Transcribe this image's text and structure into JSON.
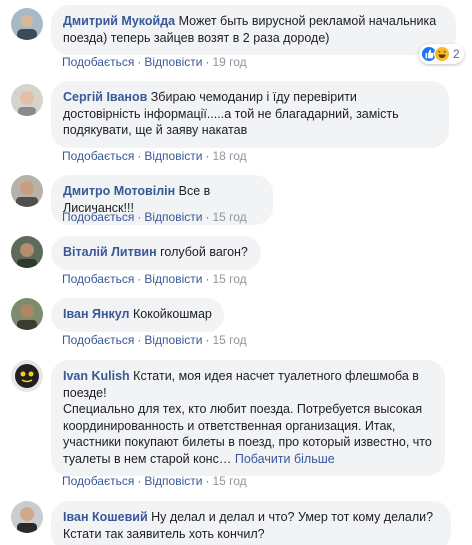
{
  "actions": {
    "like": "Подобається",
    "reply": "Відповісти",
    "separator": "·"
  },
  "reactions": {
    "count": "2",
    "icons": [
      "like-icon",
      "haha-icon"
    ]
  },
  "comments": [
    {
      "author": "Дмитрий Мукойда",
      "text": "Может быть вирусной рекламой начальника поезда) теперь зайцев возят в 2 раза дороде)",
      "time": "19 год"
    },
    {
      "author": "Сергій Іванов",
      "text": "Збираю чемоданир і їду перевірити достовірність інформації.....а той не благадарний, замість подякувати, ще й заяву накатав",
      "time": "18 год"
    },
    {
      "author": "Дмитро Мотовілін",
      "text": "Все в Лисичанск!!!",
      "time": "15 год"
    },
    {
      "author": "Віталій Литвин",
      "text": "голубой вагон?",
      "time": "15 год"
    },
    {
      "author": "Іван Янкул",
      "text": "Кокойкошмар",
      "time": "15 год"
    },
    {
      "author": "Ivan Kulish",
      "text": "Кстати, моя идея насчет туалетного флешмоба в поезде!",
      "text2": "Специально для тех, кто любит поезда. Потребуется высокая координированность и ответственная организация. Итак, участники покупают билеты в поезд, про который известно, что туалеты в нем старой конс…",
      "see_more": "Побачити більше",
      "time": "15 год"
    },
    {
      "author": "Іван Кошевий",
      "text": "Ну делал и делал и что? Умер тот кому делали? Кстати так заявитель хоть кончил?"
    }
  ]
}
